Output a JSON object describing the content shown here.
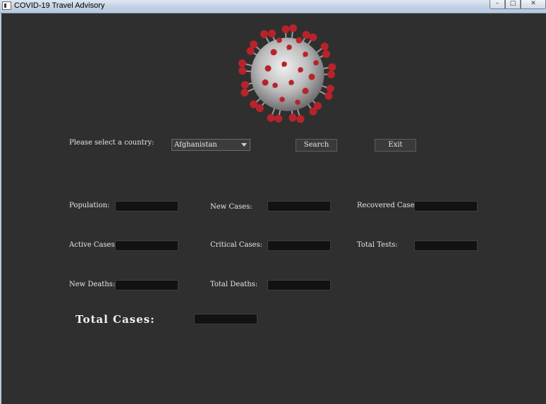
{
  "window": {
    "title": "COVID-19 Travel Advisory",
    "icon": "app-icon",
    "controls": {
      "minimize": "–",
      "maximize": "□",
      "close": "✕"
    }
  },
  "image": {
    "icon": "coronavirus-illustration",
    "colors": {
      "spike": "#b8232b",
      "body": "#d9d9d9"
    }
  },
  "country_selector": {
    "label": "Please select a country:",
    "selected": "Afghanistan"
  },
  "buttons": {
    "search": "Search",
    "exit": "Exit"
  },
  "stats": {
    "population": {
      "label": "Population:",
      "value": ""
    },
    "new_cases": {
      "label": "New Cases:",
      "value": ""
    },
    "recovered_cases": {
      "label": "Recovered Cases:",
      "value": ""
    },
    "active_cases": {
      "label": "Active Cases:",
      "value": ""
    },
    "critical_cases": {
      "label": "Critical Cases:",
      "value": ""
    },
    "total_tests": {
      "label": "Total Tests:",
      "value": ""
    },
    "new_deaths": {
      "label": "New Deaths:",
      "value": ""
    },
    "total_deaths": {
      "label": "Total Deaths:",
      "value": ""
    },
    "total_cases": {
      "label": "Total Cases:",
      "value": ""
    }
  },
  "colors": {
    "background": "#2f2f2f",
    "field": "#121212",
    "text": "#e6e6e6"
  }
}
